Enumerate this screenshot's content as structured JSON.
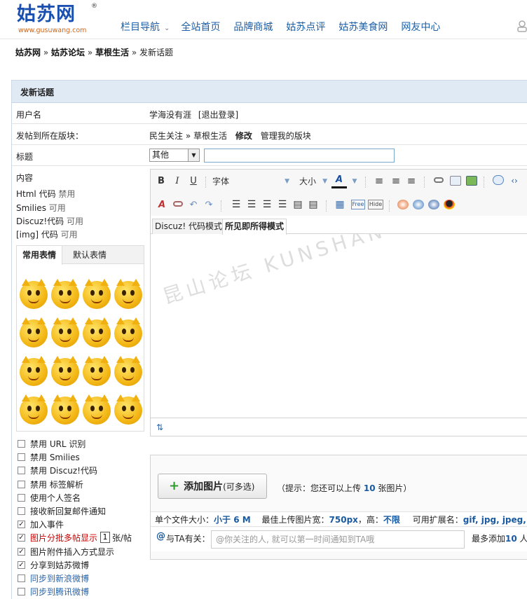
{
  "header": {
    "logo_text": "姑苏网",
    "logo_reg": "®",
    "logo_url": "www.gusuwang.com",
    "nav": [
      {
        "label": "栏目导航"
      },
      {
        "label": "全站首页"
      },
      {
        "label": "品牌商城"
      },
      {
        "label": "姑苏点评"
      },
      {
        "label": "姑苏美食网"
      },
      {
        "label": "网友中心"
      }
    ]
  },
  "breadcrumb": {
    "items": [
      "姑苏网",
      "姑苏论坛",
      "草根生活",
      "发新话题"
    ],
    "separator": "»"
  },
  "form": {
    "heading": "发新话题",
    "username_label": "用户名",
    "username": "学海没有涯",
    "logout_label": "[退出登录]",
    "forum_label": "发帖到所在版块：",
    "forum_path_1": "民生关注",
    "forum_path_2": "草根生活",
    "forum_modify": "修改",
    "forum_manage": "管理我的版块",
    "title_label": "标题",
    "title_type": "其他",
    "title_value": "",
    "content_label": "内容",
    "content_rules": [
      {
        "name": "Html 代码",
        "state": "禁用"
      },
      {
        "name": "Smilies",
        "state": "可用"
      },
      {
        "name": "Discuz!代码",
        "state": "可用"
      },
      {
        "name": "[img] 代码",
        "state": "可用"
      }
    ]
  },
  "smilies": {
    "tabs": [
      "常用表情",
      "默认表情"
    ],
    "items": [
      "cat-grin",
      "cat-dance",
      "cat-laugh",
      "cat-wave",
      "cat-cry",
      "cat-love",
      "cat-cool",
      "cat-shy",
      "cat-daze",
      "cat-bored",
      "cat-sleep",
      "cat-sunglasses",
      "cat-girl",
      "cat-surprised",
      "cat-faint",
      "cat-sign"
    ]
  },
  "editor": {
    "font_label": "字体",
    "size_label": "大小",
    "mode_tabs": [
      "Discuz! 代码模式",
      "所见即所得模式"
    ],
    "watermark": "昆山论坛 KUNSHAN BBS",
    "toolbar_icons": [
      "bold-icon",
      "italic-icon",
      "underline-icon",
      "font-color-icon",
      "align-left-icon",
      "align-center-icon",
      "align-right-icon",
      "link-icon",
      "email-icon",
      "image-icon",
      "quote-icon",
      "code-icon",
      "remove-format-icon",
      "unlink-icon",
      "undo-icon",
      "redo-icon",
      "ordered-list-icon",
      "unordered-list-icon",
      "outdent-icon",
      "indent-icon",
      "float-left-icon",
      "float-right-icon",
      "table-icon",
      "free-icon",
      "hide-icon",
      "media-icon",
      "swf-icon",
      "flash-icon",
      "qq-icon"
    ]
  },
  "options": [
    {
      "label": "禁用 URL 识别",
      "checked": false,
      "style": "normal"
    },
    {
      "label": "禁用 Smilies",
      "checked": false,
      "style": "normal"
    },
    {
      "label": "禁用 Discuz!代码",
      "checked": false,
      "style": "normal"
    },
    {
      "label": "禁用 标签解析",
      "checked": false,
      "style": "normal"
    },
    {
      "label": "使用个人签名",
      "checked": false,
      "style": "normal"
    },
    {
      "label": "接收新回复邮件通知",
      "checked": false,
      "style": "normal"
    },
    {
      "label": "加入事件",
      "checked": true,
      "style": "normal"
    },
    {
      "label": "图片分批多帖显示",
      "checked": true,
      "style": "red"
    },
    {
      "label": "图片附件插入方式显示",
      "checked": true,
      "style": "normal"
    },
    {
      "label": "分享到姑苏微博",
      "checked": true,
      "style": "normal"
    },
    {
      "label": "同步到新浪微博",
      "checked": false,
      "style": "blue"
    },
    {
      "label": "同步到腾讯微博",
      "checked": false,
      "style": "blue"
    }
  ],
  "pages_per_post": {
    "value": "1",
    "suffix": "张/帖"
  },
  "attach": {
    "add_button": "添加图片",
    "add_button_sub": "(可多选)",
    "hint_prefix": "（提示：您还可以上传",
    "hint_count": "10",
    "hint_suffix": "张图片）",
    "size_label": "单个文件大小：",
    "size_value": "小于 6 M",
    "width_label": "最佳上传图片宽：",
    "width_value": "750px",
    "height_label": "，高：",
    "height_value": "不限",
    "ext_label": "可用扩展名：",
    "ext_value": "gif, jpg, jpeg, png",
    "tag_at": "@",
    "tag_label": "与TA有关：",
    "tag_placeholder": "@你关注的人, 就可以第一时间通知到TA哦",
    "tag_max_prefix": "最多添加",
    "tag_max_value": "10",
    "tag_max_suffix": "人"
  },
  "colors": {
    "link": "#1b5fa8",
    "header_bg": "#dfeaf5",
    "red": "#c00000"
  }
}
